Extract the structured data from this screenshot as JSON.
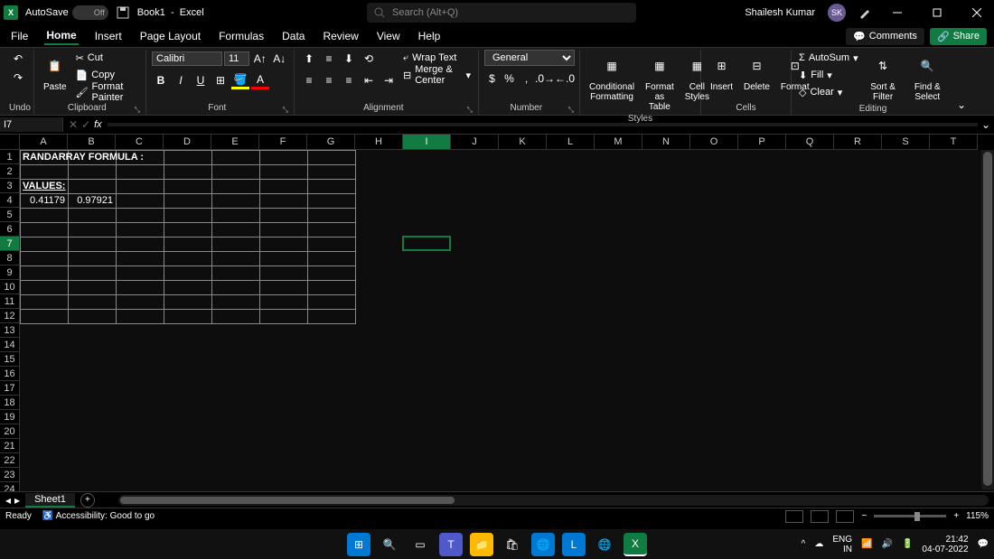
{
  "app": {
    "product": "Excel",
    "doc_name": "Book1",
    "autosave_label": "AutoSave",
    "autosave_state": "Off",
    "search_placeholder": "Search (Alt+Q)",
    "user_name": "Shailesh Kumar",
    "user_initials": "SK"
  },
  "tabs": {
    "file": "File",
    "home": "Home",
    "insert": "Insert",
    "page_layout": "Page Layout",
    "formulas": "Formulas",
    "data": "Data",
    "review": "Review",
    "view": "View",
    "help": "Help",
    "comments": "Comments",
    "share": "Share"
  },
  "ribbon": {
    "undo_group": "Undo",
    "clipboard": {
      "label": "Clipboard",
      "paste": "Paste",
      "cut": "Cut",
      "copy": "Copy",
      "format_painter": "Format Painter"
    },
    "font": {
      "label": "Font",
      "name": "Calibri",
      "size": "11"
    },
    "alignment": {
      "label": "Alignment",
      "wrap": "Wrap Text",
      "merge": "Merge & Center"
    },
    "number": {
      "label": "Number",
      "format": "General"
    },
    "styles": {
      "label": "Styles",
      "conditional": "Conditional\nFormatting",
      "table": "Format as\nTable",
      "cell": "Cell\nStyles"
    },
    "cells": {
      "label": "Cells",
      "insert": "Insert",
      "delete": "Delete",
      "format": "Format"
    },
    "editing": {
      "label": "Editing",
      "autosum": "AutoSum",
      "fill": "Fill",
      "clear": "Clear",
      "sort": "Sort &\nFilter",
      "find": "Find &\nSelect"
    }
  },
  "formula_bar": {
    "cell_ref": "I7",
    "formula": ""
  },
  "grid": {
    "columns": [
      "A",
      "B",
      "C",
      "D",
      "E",
      "F",
      "G",
      "H",
      "I",
      "J",
      "K",
      "L",
      "M",
      "N",
      "O",
      "P",
      "Q",
      "R",
      "S",
      "T"
    ],
    "rows": [
      1,
      2,
      3,
      4,
      5,
      6,
      7,
      8,
      9,
      10,
      11,
      12,
      13,
      14,
      15,
      16,
      17,
      18,
      19,
      20,
      21,
      22,
      23,
      24
    ],
    "active_cell": "I7",
    "data": {
      "A1": "RANDARRAY FORMULA :",
      "A3": "VALUES:",
      "A4": "0.41179",
      "B4": "0.97921"
    }
  },
  "sheets": {
    "active": "Sheet1"
  },
  "status": {
    "ready": "Ready",
    "accessibility": "Accessibility: Good to go",
    "zoom": "115%"
  },
  "taskbar": {
    "lang1": "ENG",
    "lang2": "IN",
    "time": "21:42",
    "date": "04-07-2022"
  }
}
